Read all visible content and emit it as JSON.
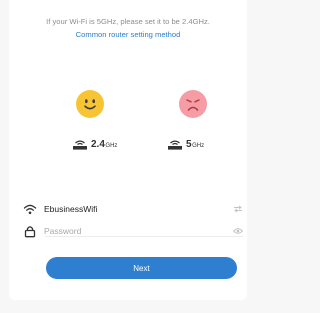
{
  "tip": {
    "text": "If your Wi-Fi is 5GHz, please set it to be 2.4GHz.",
    "link": "Common router setting method"
  },
  "bands": [
    {
      "value": "2.4",
      "unit": "GHz",
      "status": "supported",
      "face_icon": "happy-face-icon",
      "color": "#f7c533"
    },
    {
      "value": "5",
      "unit": "GHz",
      "status": "unsupported",
      "face_icon": "sad-face-icon",
      "color": "#f59ca4"
    }
  ],
  "form": {
    "ssid": "EbusinessWifi",
    "ssid_icon": "wifi-icon",
    "ssid_action_icon": "switch-arrows-icon",
    "password_placeholder": "Password",
    "password_value": "",
    "password_icon": "lock-icon",
    "password_action_icon": "eye-icon"
  },
  "next_label": "Next",
  "colors": {
    "accent": "#2f7fd1",
    "link": "#2a7fcf",
    "background": "#f7f7f7"
  }
}
